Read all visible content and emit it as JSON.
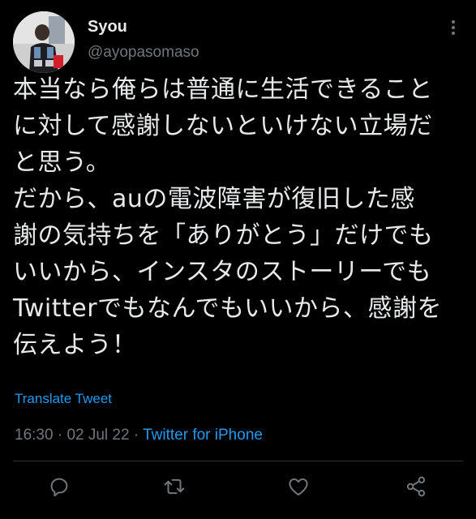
{
  "user": {
    "display_name": "Syou",
    "handle": "@ayopasomaso"
  },
  "tweet": {
    "text": "本当なら俺らは普通に生活できること\nに対して感謝しないといけない立場だ\nと思う。\nだから、auの電波障害が復旧した感\n謝の気持ちを「ありがとう」だけでも\nいいから、インスタのストーリーでも\nTwitterでもなんでもいいから、感謝を\n伝えよう！",
    "translate_label": "Translate Tweet",
    "time": "16:30",
    "date": "02 Jul 22",
    "separator": " · ",
    "source": "Twitter for iPhone"
  },
  "actions": {
    "reply_icon": "reply-icon",
    "retweet_icon": "retweet-icon",
    "like_icon": "like-icon",
    "share_icon": "share-icon"
  },
  "colors": {
    "background": "#000000",
    "text": "#e7e9ea",
    "secondary": "#71767b",
    "accent": "#1d9bf0",
    "divider": "#2f3336"
  }
}
